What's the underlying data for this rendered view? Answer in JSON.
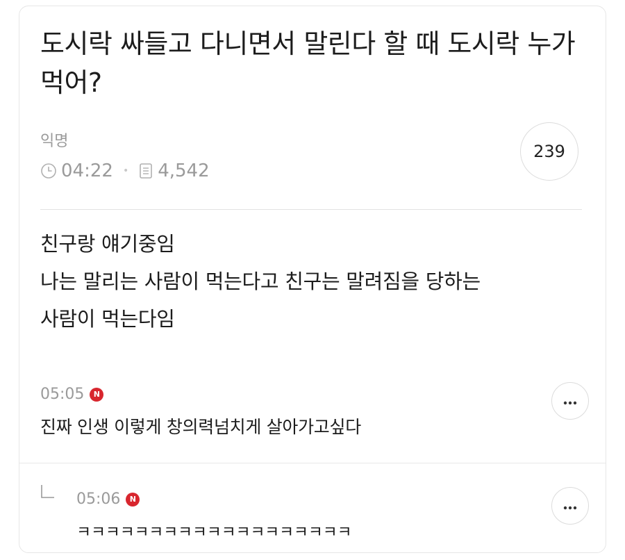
{
  "post": {
    "title": "도시락 싸들고 다니면서 말린다 할 때 도시락 누가먹어?",
    "author": "익명",
    "time": "04:22",
    "views": "4,542",
    "comment_count": "239",
    "body_lines": [
      "친구랑 얘기중임",
      "나는 말리는 사람이 먹는다고 친구는 말려짐을 당하는",
      "사람이 먹는다임"
    ]
  },
  "comments": [
    {
      "time": "05:05",
      "badge": "N",
      "text": "진짜 인생 이렇게 창의력넘치게 살아가고싶다"
    },
    {
      "time": "05:06",
      "badge": "N",
      "text": "ㅋㅋㅋㅋㅋㅋㅋㅋㅋㅋㅋㅋㅋㅋㅋㅋㅋㅋㅋ",
      "is_reply": true
    }
  ],
  "icons": {
    "clock": "clock-icon",
    "views": "document-icon",
    "more": "more-dots-icon",
    "reply": "reply-arrow-icon"
  },
  "colors": {
    "badge": "#d8262e",
    "meta": "#9a9a9a",
    "text": "#1c1c1c"
  }
}
